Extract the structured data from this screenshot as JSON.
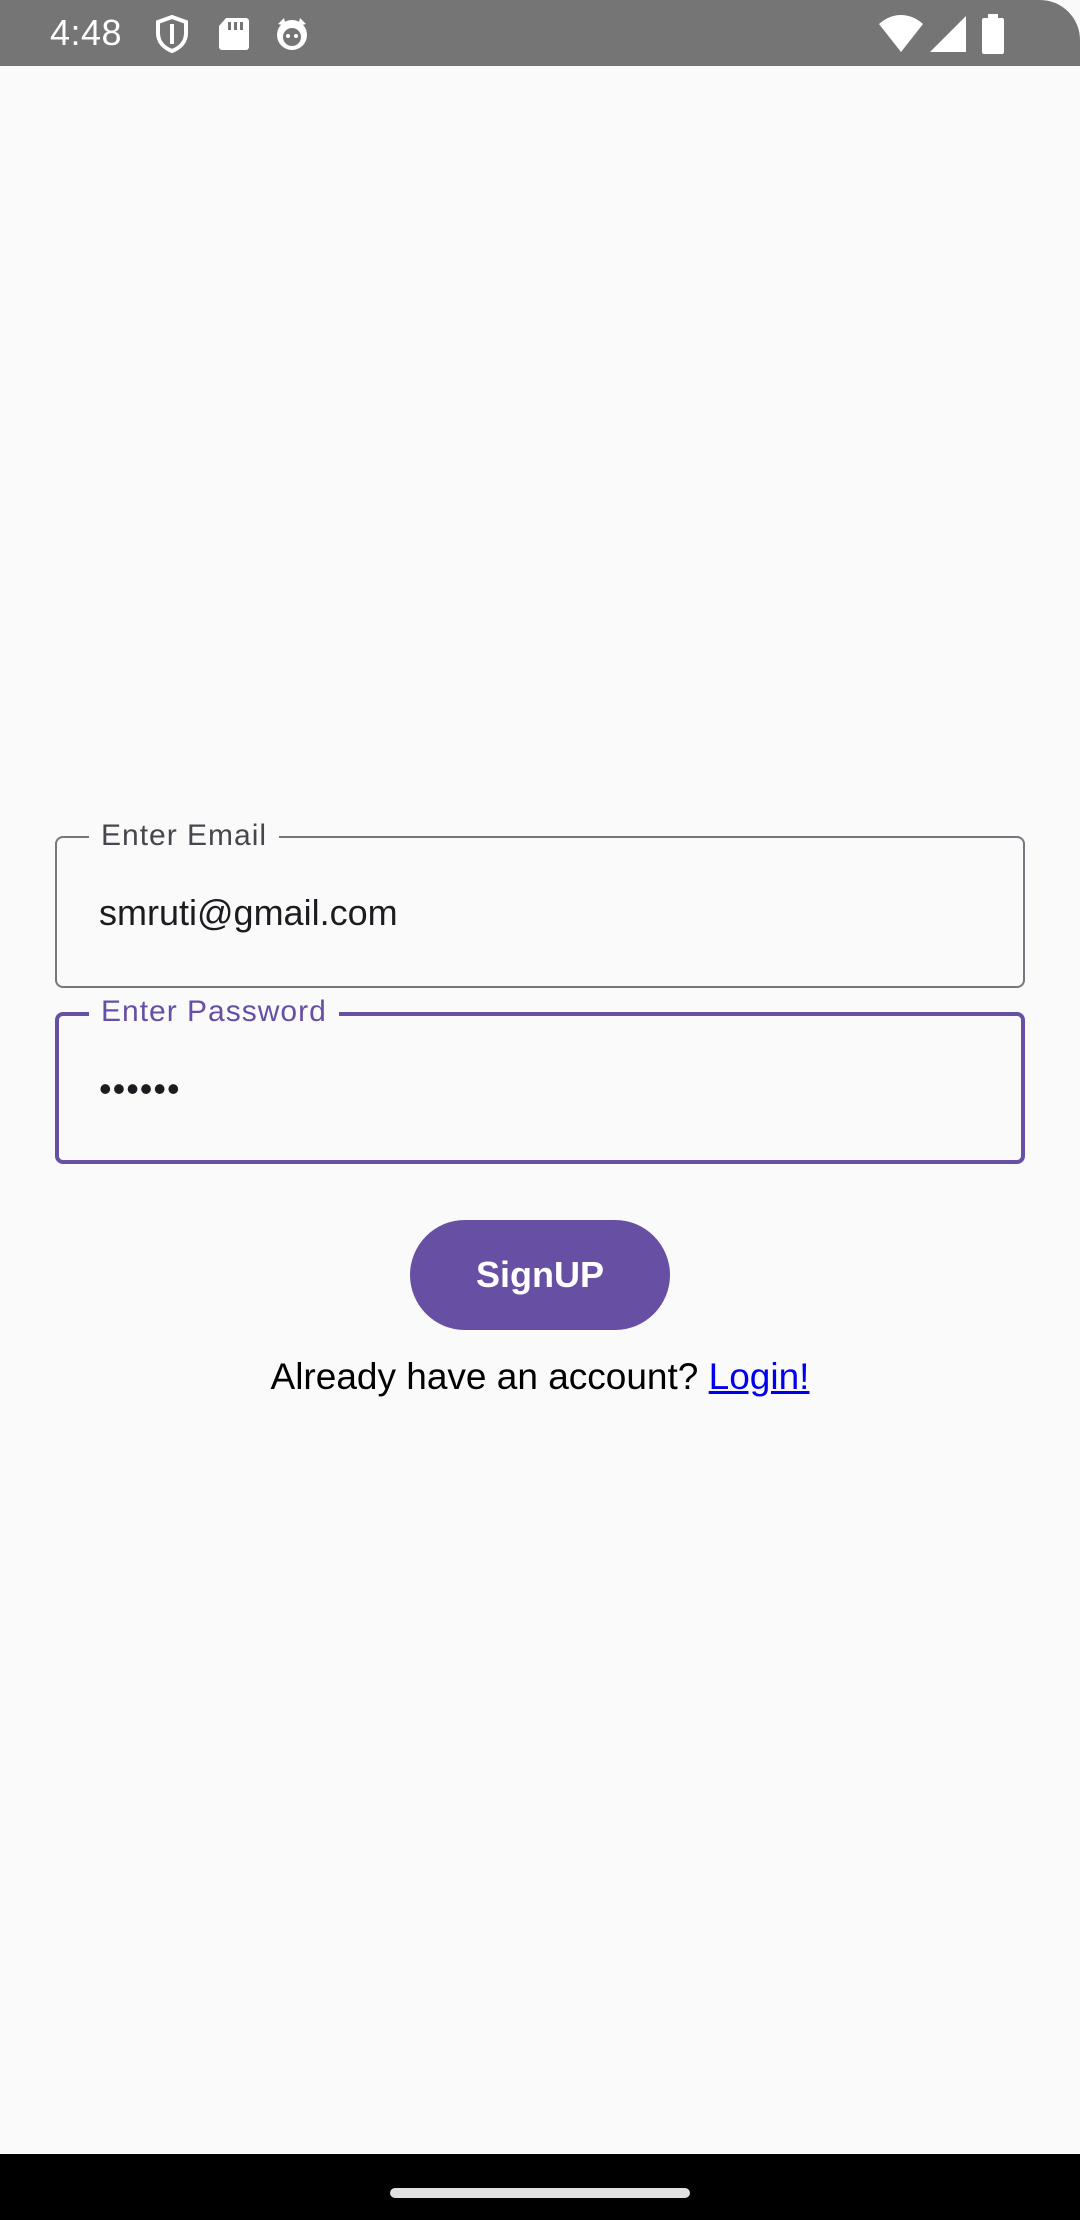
{
  "status_bar": {
    "time": "4:48",
    "icons": [
      "shield-icon",
      "sd-card-icon",
      "cat-icon",
      "wifi-icon",
      "cellular-signal-icon",
      "battery-icon"
    ]
  },
  "form": {
    "email": {
      "label": "Enter Email",
      "value": "smruti@gmail.com"
    },
    "password": {
      "label": "Enter Password",
      "value": "••••••"
    },
    "signup_label": "SignUP",
    "login_prompt": "Already have an account?",
    "login_link": "Login!"
  },
  "colors": {
    "accent": "#6750a4",
    "outline": "#79747e",
    "background": "#fafafa",
    "link": "#0000ee"
  }
}
